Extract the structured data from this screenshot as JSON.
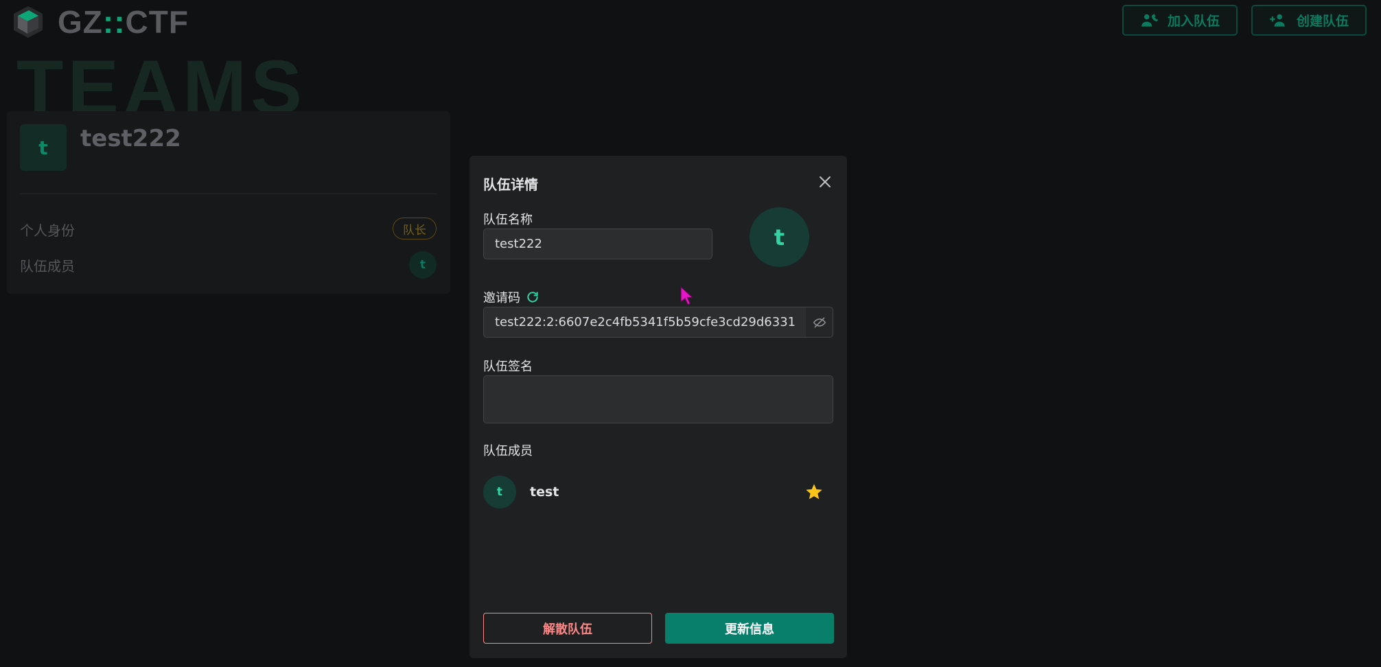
{
  "brand": {
    "name_left": "GZ",
    "name_sep": "::",
    "name_right": "CTF"
  },
  "header_actions": {
    "join_team": "加入队伍",
    "create_team": "创建队伍"
  },
  "page": {
    "title": "TEAMS"
  },
  "team_card": {
    "avatar_letter": "t",
    "name": "test222",
    "role_label": "个人身份",
    "role_badge": "队长",
    "members_label": "队伍成员",
    "member_letter": "t"
  },
  "modal": {
    "title": "队伍详情",
    "team_name_label": "队伍名称",
    "team_name_value": "test222",
    "avatar_letter": "t",
    "invite_label": "邀请码",
    "invite_code": "test222:2:6607e2c4fb5341f5b59cfe3cd29d6331",
    "signature_label": "队伍签名",
    "signature_value": "",
    "members_label": "队伍成员",
    "members": [
      {
        "letter": "t",
        "name": "test",
        "is_captain": true
      }
    ],
    "disband_button": "解散队伍",
    "update_button": "更新信息"
  },
  "colors": {
    "accent": "#087f6b",
    "accent_light": "#35d3a4",
    "danger": "#ff8787",
    "star": "#fcc419",
    "cursor": "#e815c8"
  },
  "icons": {
    "logo": "gzctf-logo-icon",
    "join": "phone-user-icon",
    "create": "user-plus-icon",
    "close": "close-icon",
    "refresh": "refresh-icon",
    "eye_off": "eye-off-icon",
    "star": "star-icon"
  }
}
